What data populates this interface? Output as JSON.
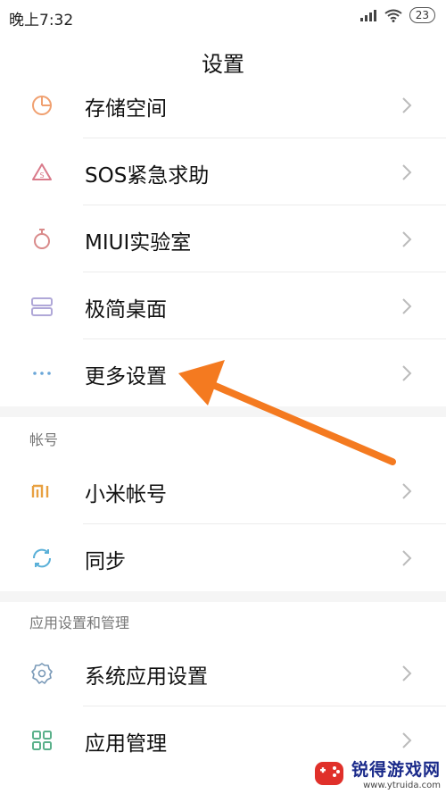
{
  "status_bar": {
    "time": "晚上7:32",
    "battery": "23"
  },
  "header": {
    "title": "设置"
  },
  "group1": [
    {
      "label": "存储空间",
      "icon": "storage-pie-icon"
    },
    {
      "label": "SOS紧急求助",
      "icon": "sos-warning-icon"
    },
    {
      "label": "MIUI实验室",
      "icon": "lab-flask-icon"
    },
    {
      "label": "极简桌面",
      "icon": "simple-desktop-icon"
    },
    {
      "label": "更多设置",
      "icon": "more-dots-icon"
    }
  ],
  "section_account": {
    "title": "帐号",
    "items": [
      {
        "label": "小米帐号",
        "icon": "mi-logo-icon"
      },
      {
        "label": "同步",
        "icon": "sync-icon"
      }
    ]
  },
  "section_apps": {
    "title": "应用设置和管理",
    "items": [
      {
        "label": "系统应用设置",
        "icon": "gear-icon"
      },
      {
        "label": "应用管理",
        "icon": "app-grid-icon"
      }
    ]
  },
  "watermark": {
    "brand": "锐得游戏网",
    "url": "www.ytruida.com"
  },
  "colors": {
    "accent_arrow": "#f47a20",
    "icon_gray": "#9aa0b0"
  }
}
